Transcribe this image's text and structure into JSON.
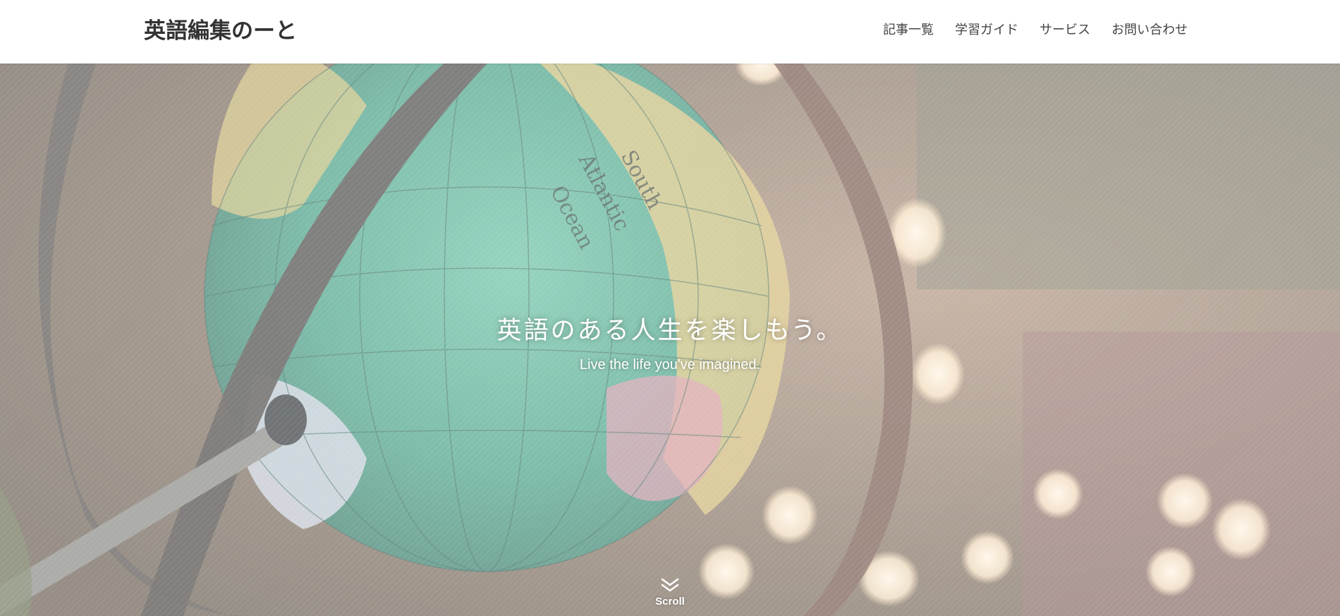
{
  "header": {
    "logo": "英語編集のーと",
    "nav": [
      {
        "label": "記事一覧"
      },
      {
        "label": "学習ガイド"
      },
      {
        "label": "サービス"
      },
      {
        "label": "お問い合わせ"
      }
    ]
  },
  "hero": {
    "catchphrase": "英語のある人生を楽しもう。",
    "subtitle": "Live the life you've imagined.",
    "scroll_label": "Scroll",
    "scroll_icon": "double-chevron-down-icon"
  },
  "colors": {
    "header_bg": "#ffffff",
    "logo_text": "#333333",
    "nav_text": "#444444",
    "hero_text": "#ffffff"
  }
}
